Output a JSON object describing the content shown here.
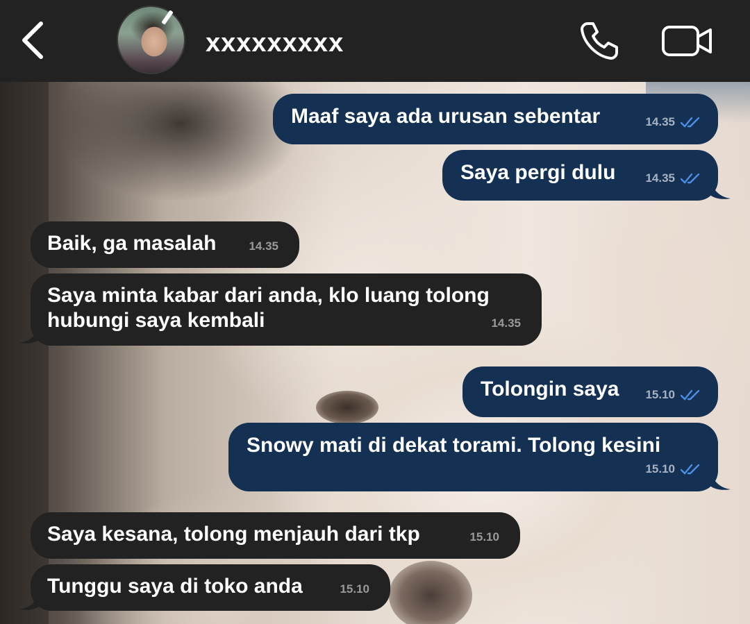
{
  "header": {
    "contact_name": "xxxxxxxxx",
    "back_icon": "chevron-left-icon",
    "call_icon": "phone-icon",
    "video_icon": "video-camera-icon"
  },
  "colors": {
    "header_bg": "#222222",
    "outgoing_bubble": "#143052",
    "incoming_bubble": "#222222",
    "read_tick": "#4d8fe6"
  },
  "messages": [
    {
      "direction": "outgoing",
      "text": "Maaf saya ada urusan sebentar",
      "time": "14.35",
      "status": "read"
    },
    {
      "direction": "outgoing",
      "text": "Saya pergi dulu",
      "time": "14.35",
      "status": "read"
    },
    {
      "direction": "incoming",
      "text": "Baik, ga masalah",
      "time": "14.35"
    },
    {
      "direction": "incoming",
      "text_lines": [
        "Saya minta kabar dari anda, klo luang tolong",
        "hubungi saya kembali"
      ],
      "time": "14.35"
    },
    {
      "direction": "outgoing",
      "text": "Tolongin saya",
      "time": "15.10",
      "status": "read"
    },
    {
      "direction": "outgoing",
      "text": "Snowy mati di dekat torami. Tolong kesini",
      "time": "15.10",
      "status": "read"
    },
    {
      "direction": "incoming",
      "text": "Saya kesana, tolong menjauh dari tkp",
      "time": "15.10"
    },
    {
      "direction": "incoming",
      "text": "Tunggu saya di toko anda",
      "time": "15.10"
    }
  ]
}
